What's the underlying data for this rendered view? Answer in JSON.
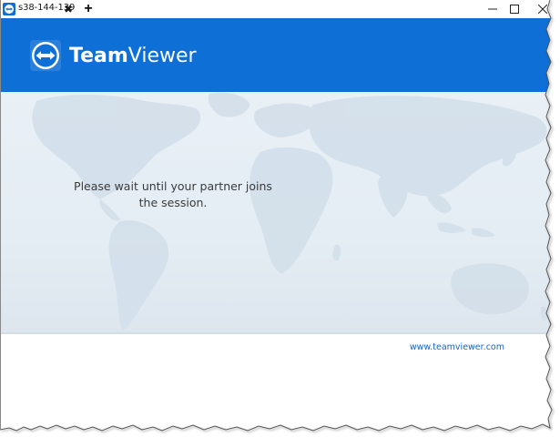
{
  "tab": {
    "title": "s38-144-139",
    "close_glyph": "✖",
    "icon": "teamviewer-logo-icon"
  },
  "new_tab_glyph": "+",
  "window_controls": {
    "minimize": "—",
    "maximize": "☐",
    "close": "✕"
  },
  "header": {
    "brand_bold": "Team",
    "brand_light": "Viewer",
    "brand_color": "#0e6fd6"
  },
  "main": {
    "message": "Please wait until your partner joins the session."
  },
  "footer": {
    "website": "www.teamviewer.com",
    "link_color": "#1166cc"
  }
}
